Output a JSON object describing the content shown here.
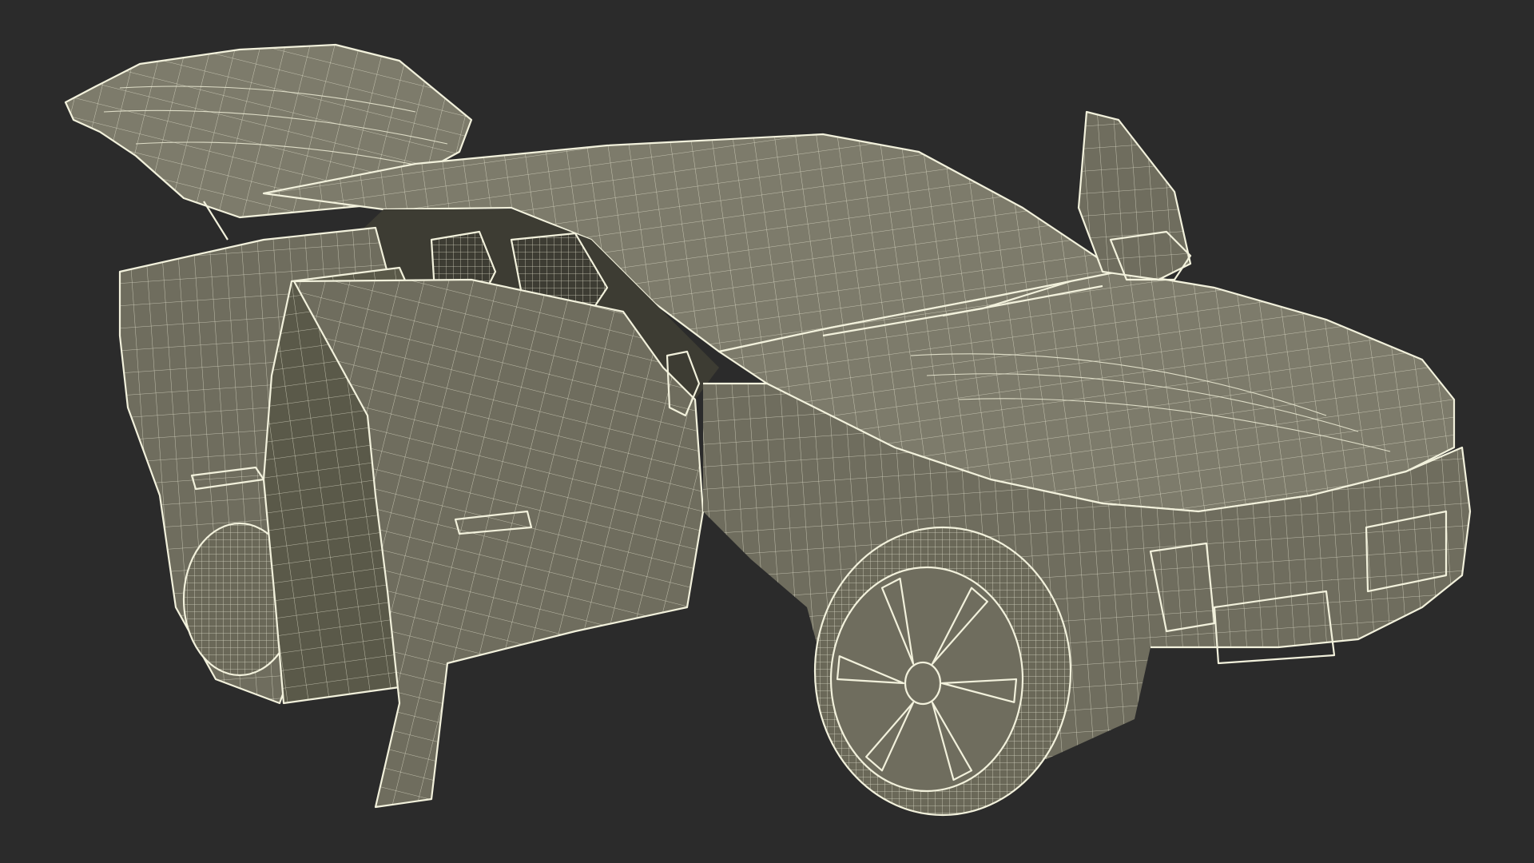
{
  "scene": {
    "subject": "car-wireframe",
    "colors": {
      "background": "#2b2b2b",
      "surface": "#6f6d5e",
      "surface_dark": "#5a5949",
      "surface_light": "#7d7b6b",
      "cabin": "#3d3c33",
      "wire": "#e9e8d2",
      "edge": "#f2f1dc",
      "tire": "#6a6858"
    }
  }
}
